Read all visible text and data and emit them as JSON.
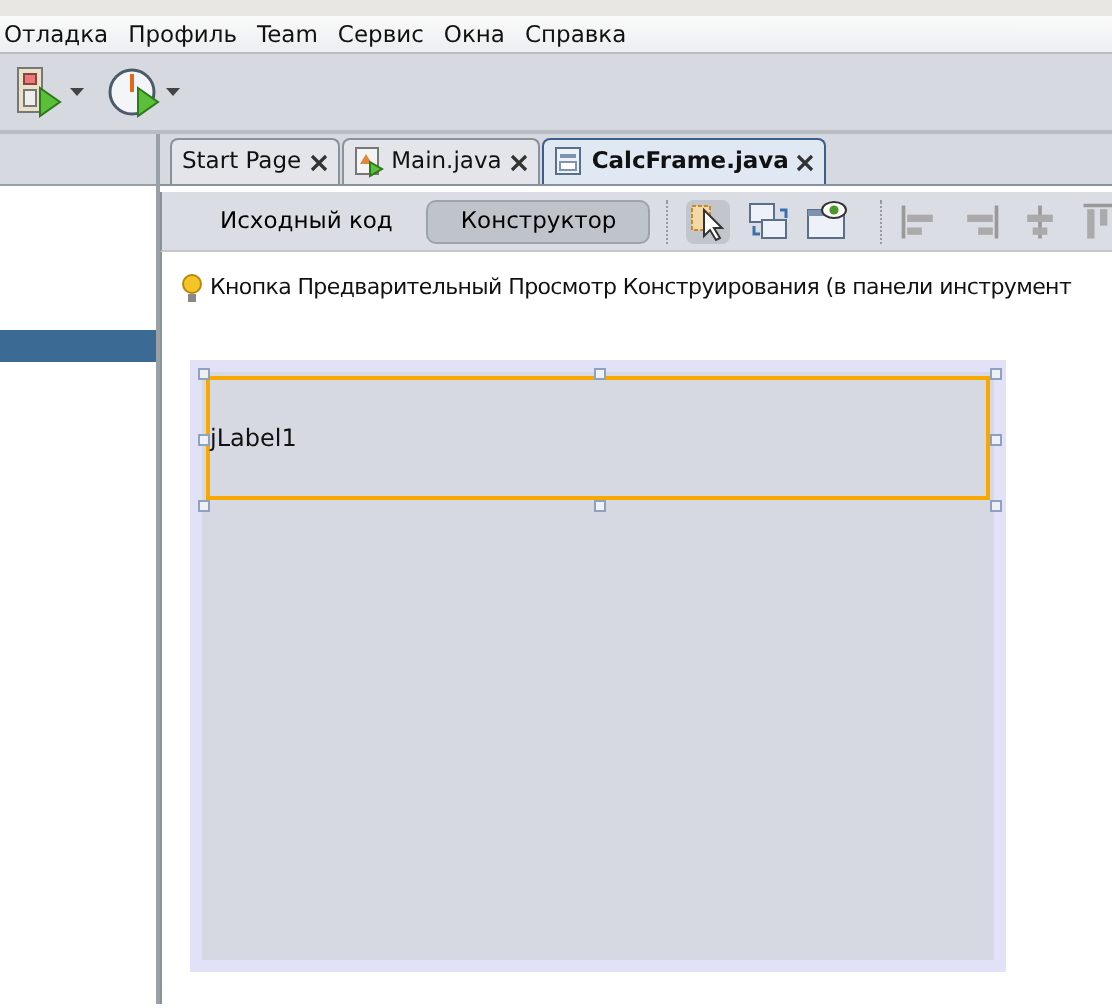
{
  "menu": [
    {
      "label": "Отладка"
    },
    {
      "label": "Профиль"
    },
    {
      "label": "Team"
    },
    {
      "label": "Сервис"
    },
    {
      "label": "Окна"
    },
    {
      "label": "Справка"
    }
  ],
  "editor_tabs": [
    {
      "label": "Start Page",
      "kind": "page",
      "selected": false
    },
    {
      "label": "Main.java",
      "kind": "class",
      "selected": false
    },
    {
      "label": "CalcFrame.java",
      "kind": "form",
      "selected": true
    }
  ],
  "views": [
    {
      "label": "Исходный код",
      "selected": false
    },
    {
      "label": "Конструктор",
      "selected": true
    }
  ],
  "hint": "Кнопка Предварительный Просмотр Конструирования (в панели инструмент",
  "form": {
    "label": "jLabel1",
    "selected": true
  }
}
